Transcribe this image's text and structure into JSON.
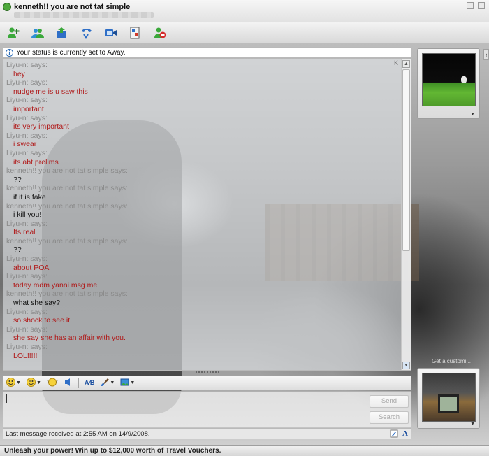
{
  "window": {
    "title": "kenneth!! you are not tat simple"
  },
  "toolbar": {
    "items": [
      {
        "icon": "invite-contact-icon"
      },
      {
        "icon": "contacts-icon"
      },
      {
        "icon": "share-files-icon"
      },
      {
        "icon": "call-icon"
      },
      {
        "icon": "video-icon"
      },
      {
        "icon": "activities-icon"
      },
      {
        "icon": "block-icon"
      }
    ]
  },
  "status_bar": {
    "text": "Your status is currently set to Away."
  },
  "conversation": {
    "k_label": "K",
    "messages": [
      {
        "sender": "Liyu-n: says:",
        "text": "hey",
        "color": "red"
      },
      {
        "sender": "Liyu-n: says:",
        "text": "nudge me is u saw this",
        "color": "red"
      },
      {
        "sender": "Liyu-n: says:",
        "text": "important",
        "color": "red"
      },
      {
        "sender": "Liyu-n: says:",
        "text": "its very important",
        "color": "red"
      },
      {
        "sender": "Liyu-n: says:",
        "text": "i swear",
        "color": "red"
      },
      {
        "sender": "Liyu-n: says:",
        "text": "its abt prelims",
        "color": "red"
      },
      {
        "sender": "kenneth!! you are not tat simple says:",
        "text": "??",
        "color": "black"
      },
      {
        "sender": "kenneth!! you are not tat simple says:",
        "text": "if it is fake",
        "color": "black"
      },
      {
        "sender": "kenneth!! you are not tat simple says:",
        "text": "i kill  you!",
        "color": "black"
      },
      {
        "sender": "Liyu-n: says:",
        "text": "Its real",
        "color": "red"
      },
      {
        "sender": "kenneth!! you are not tat simple says:",
        "text": "??",
        "color": "black"
      },
      {
        "sender": "Liyu-n: says:",
        "text": "about POA",
        "color": "red"
      },
      {
        "sender": "Liyu-n: says:",
        "text": "today mdm yanni msg me",
        "color": "red"
      },
      {
        "sender": "kenneth!! you are not tat simple says:",
        "text": "what she say?",
        "color": "black"
      },
      {
        "sender": "Liyu-n: says:",
        "text": "so shock to see it",
        "color": "red"
      },
      {
        "sender": "Liyu-n: says:",
        "text": "she say she has an affair with you.",
        "color": "red"
      },
      {
        "sender": "Liyu-n: says:",
        "text": "LOL!!!!!",
        "color": "red"
      }
    ]
  },
  "compose": {
    "send_label": "Send",
    "search_label": "Search",
    "input_value": ""
  },
  "footer": {
    "last_message": "Last message received at 2:55 AM on 14/9/2008.",
    "font_icon_label": "A"
  },
  "ad": {
    "text": "Unleash your power! Win up to $12,000 worth of Travel Vouchers."
  },
  "side": {
    "text": "Get a customi..."
  },
  "colors": {
    "sender_gray": "#8a8a8a",
    "message_red": "#b01a1a",
    "message_black": "#111111"
  }
}
